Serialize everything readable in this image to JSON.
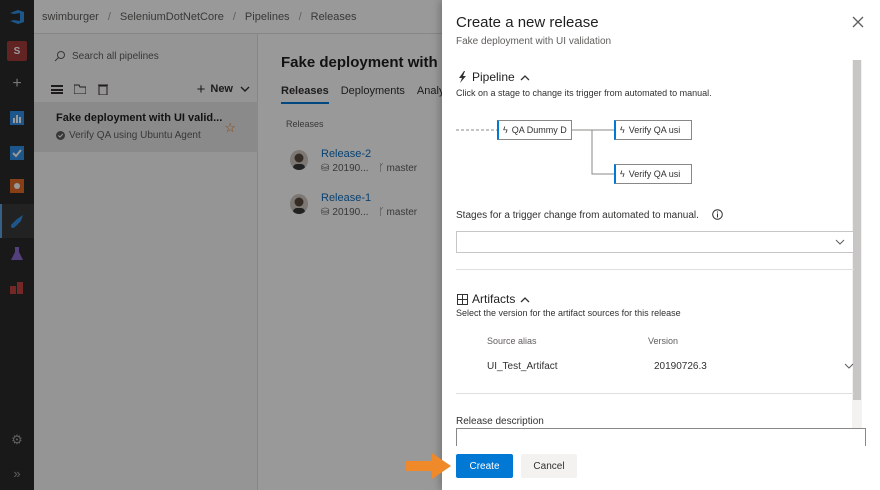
{
  "breadcrumb": [
    "swimburger",
    "SeleniumDotNetCore",
    "Pipelines",
    "Releases"
  ],
  "sidebar": {
    "project_initial": "S",
    "search_placeholder": "Search all pipelines",
    "new_label": "New",
    "pipeline": {
      "name": "Fake deployment with UI valid...",
      "status": "Verify QA using Ubuntu Agent"
    }
  },
  "main": {
    "title": "Fake deployment with UI",
    "tabs": [
      "Releases",
      "Deployments",
      "Analytics"
    ],
    "column_header": "Releases",
    "releases": [
      {
        "name": "Release-2",
        "build": "20190...",
        "branch": "master"
      },
      {
        "name": "Release-1",
        "build": "20190...",
        "branch": "master"
      }
    ]
  },
  "panel": {
    "title": "Create a new release",
    "subtitle": "Fake deployment with UI validation",
    "pipeline_section": {
      "heading": "Pipeline",
      "description": "Click on a stage to change its trigger from automated to manual.",
      "stages": [
        "QA Dummy D",
        "Verify QA usi",
        "Verify QA usi"
      ]
    },
    "stages_label": "Stages for a trigger change from automated to manual.",
    "artifacts_section": {
      "heading": "Artifacts",
      "description": "Select the version for the artifact sources for this release",
      "col_source": "Source alias",
      "col_version": "Version",
      "rows": [
        {
          "source": "UI_Test_Artifact",
          "version": "20190726.3"
        }
      ]
    },
    "release_description_label": "Release description",
    "create_label": "Create",
    "cancel_label": "Cancel"
  },
  "colors": {
    "accent": "#0078d4",
    "arrow": "#f0892a",
    "rail": "#2b2b2b"
  }
}
